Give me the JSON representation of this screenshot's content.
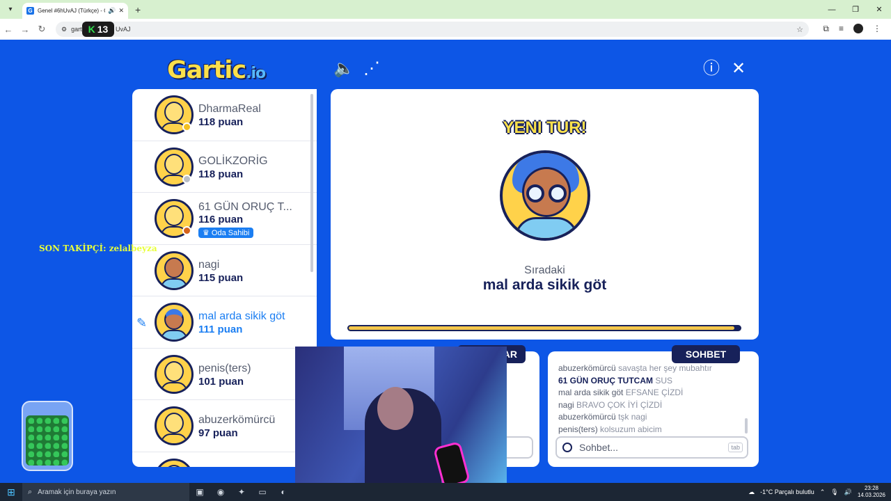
{
  "browser": {
    "tab_title": "Genel #6hUvAJ (Türkçe) - G",
    "tab_favicon": "G",
    "url_prefix": "gart",
    "url_suffix": "UvAJ",
    "overlay_badge_k": "K",
    "overlay_badge_num": "13"
  },
  "header": {
    "logo_main": "Gartic",
    "logo_suffix": ".io"
  },
  "players": [
    {
      "name": "DharmaReal",
      "score": "118 puan",
      "dot_color": "#f3c021"
    },
    {
      "name": "GOLİKZORİG",
      "score": "118 puan",
      "dot_color": "#b9bec7"
    },
    {
      "name": "61 GÜN ORUÇ T...",
      "score": "116 puan",
      "dot_color": "#d4621b",
      "badge": "Oda Sahibi"
    },
    {
      "name": "nagi",
      "score": "115 puan"
    },
    {
      "name": "mal arda sikik göt",
      "score": "111 puan"
    },
    {
      "name": "penis(ters)",
      "score": "101 puan"
    },
    {
      "name": "abuzerkömürcü",
      "score": "97 puan"
    }
  ],
  "stage": {
    "banner": "YENI TUR!",
    "next_label": "Sıradaki",
    "next_player": "mal arda sikik göt",
    "progress_fraction": 0.985
  },
  "answers": {
    "tab_label": "AR"
  },
  "chat": {
    "tab_label": "SOHBET",
    "input_placeholder": "Sohbet...",
    "tab_key": "tab",
    "lines": [
      {
        "user": "abuzerkömürcü",
        "text": "savaşta her şey mubahtır"
      },
      {
        "user": "61 GÜN ORUÇ TUTCAM",
        "text": "SUS"
      },
      {
        "user": "mal arda sikik göt",
        "text": "EFSANE ÇİZDİ"
      },
      {
        "user": "nagi",
        "text": "BRAVO ÇOK İYİ ÇİZDİ"
      },
      {
        "user": "abuzerkömürcü",
        "text": "tşk nagi"
      },
      {
        "user": "penis(ters)",
        "text": "kolsuzum abicim"
      }
    ]
  },
  "overlay": {
    "follower_text": "SON TAKİPÇİ: zelalbeyza"
  },
  "taskbar": {
    "search_placeholder": "Aramak için buraya yazın",
    "weather": "-1°C  Parçalı bulutlu",
    "time": "23:28",
    "date": "14.03.2026"
  }
}
